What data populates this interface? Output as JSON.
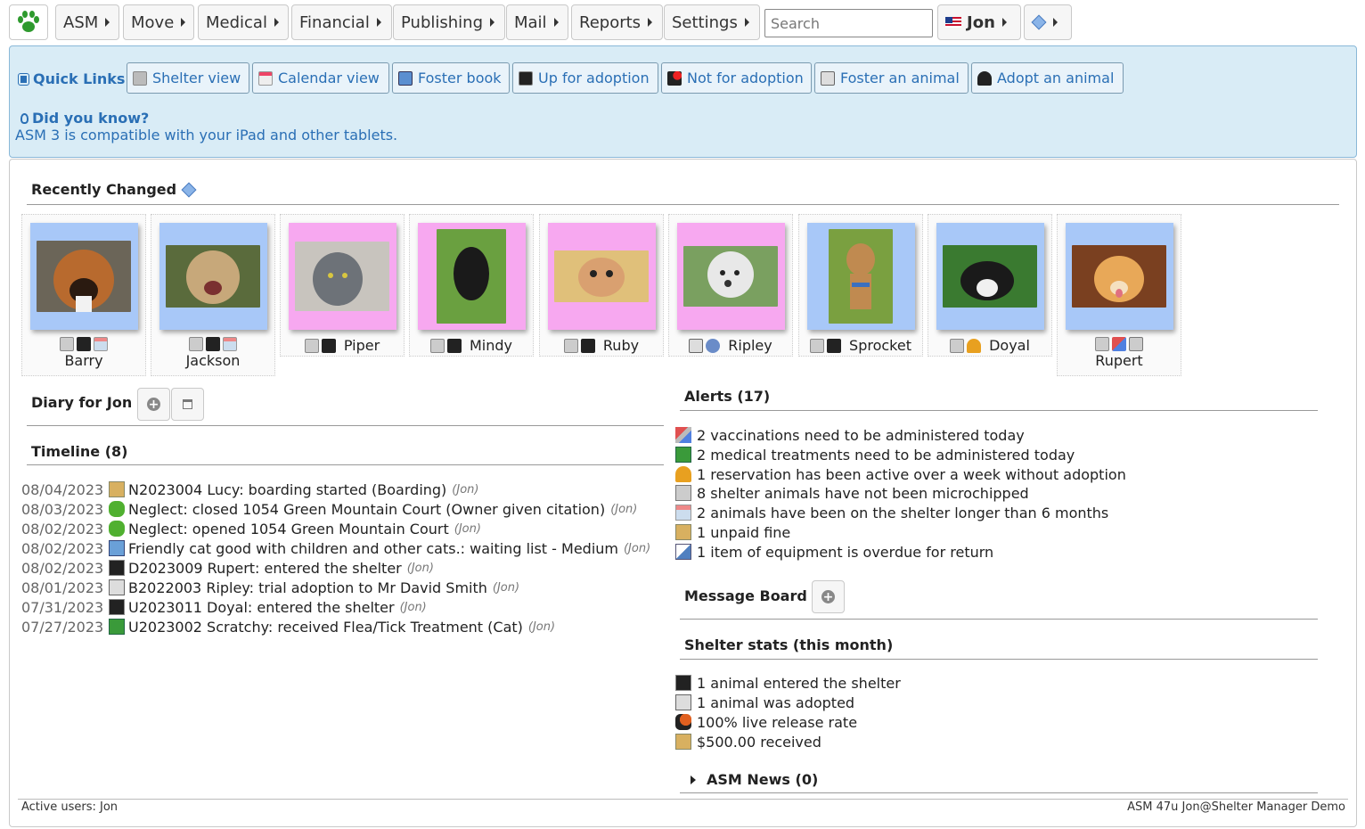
{
  "menu": {
    "items": [
      "ASM",
      "Move",
      "Medical",
      "Financial",
      "Publishing",
      "Mail",
      "Reports",
      "Settings"
    ],
    "search_placeholder": "Search",
    "user": "Jon"
  },
  "quick_links": {
    "title": "Quick Links",
    "links": [
      "Shelter view",
      "Calendar view",
      "Foster book",
      "Up for adoption",
      "Not for adoption",
      "Foster an animal",
      "Adopt an animal"
    ]
  },
  "did_you_know": {
    "title": "Did you know?",
    "text": "ASM 3 is compatible with your iPad and other tablets."
  },
  "recently_changed": {
    "title": "Recently Changed",
    "animals": [
      {
        "name": "Barry",
        "bg": "#a8c8f8"
      },
      {
        "name": "Jackson",
        "bg": "#a8c8f8"
      },
      {
        "name": "Piper",
        "bg": "#f7a8f0"
      },
      {
        "name": "Mindy",
        "bg": "#f7a8f0"
      },
      {
        "name": "Ruby",
        "bg": "#f7a8f0"
      },
      {
        "name": "Ripley",
        "bg": "#f7a8f0"
      },
      {
        "name": "Sprocket",
        "bg": "#a8c8f8"
      },
      {
        "name": "Doyal",
        "bg": "#a8c8f8"
      },
      {
        "name": "Rupert",
        "bg": "#a8c8f8"
      }
    ]
  },
  "diary": {
    "title": "Diary for Jon"
  },
  "timeline": {
    "title": "Timeline (8)",
    "entries": [
      {
        "date": "08/04/2023",
        "text": "N2023004 Lucy: boarding started (Boarding)",
        "user": "(Jon)"
      },
      {
        "date": "08/03/2023",
        "text": "Neglect: closed 1054 Green Mountain Court (Owner given citation)",
        "user": "(Jon)"
      },
      {
        "date": "08/02/2023",
        "text": "Neglect: opened 1054 Green Mountain Court",
        "user": "(Jon)"
      },
      {
        "date": "08/02/2023",
        "text": "Friendly cat good with children and other cats.: waiting list - Medium",
        "user": "(Jon)"
      },
      {
        "date": "08/02/2023",
        "text": "D2023009 Rupert: entered the shelter",
        "user": "(Jon)"
      },
      {
        "date": "08/01/2023",
        "text": "B2022003 Ripley: trial adoption to Mr David Smith",
        "user": "(Jon)"
      },
      {
        "date": "07/31/2023",
        "text": "U2023011 Doyal: entered the shelter",
        "user": "(Jon)"
      },
      {
        "date": "07/27/2023",
        "text": "U2023002 Scratchy: received Flea/Tick Treatment (Cat)",
        "user": "(Jon)"
      }
    ]
  },
  "alerts": {
    "title": "Alerts (17)",
    "items": [
      "2 vaccinations need to be administered today",
      "2 medical treatments need to be administered today",
      "1 reservation has been active over a week without adoption",
      "8 shelter animals have not been microchipped",
      "2 animals have been on the shelter longer than 6 months",
      "1 unpaid fine",
      "1 item of equipment is overdue for return"
    ]
  },
  "message_board": {
    "title": "Message Board"
  },
  "stats": {
    "title": "Shelter stats (this month)",
    "items": [
      "1 animal entered the shelter",
      "1 animal was adopted",
      "100% live release rate",
      "$500.00 received"
    ]
  },
  "news": {
    "title": "ASM News (0)"
  },
  "footer": {
    "active_users": "Active users: Jon",
    "version": "ASM 47u Jon@Shelter Manager Demo"
  },
  "colors": {
    "accent": "#2a6fb5",
    "panel_bg": "#d9ecf6",
    "blue_card": "#a8c8f8",
    "pink_card": "#f7a8f0"
  }
}
